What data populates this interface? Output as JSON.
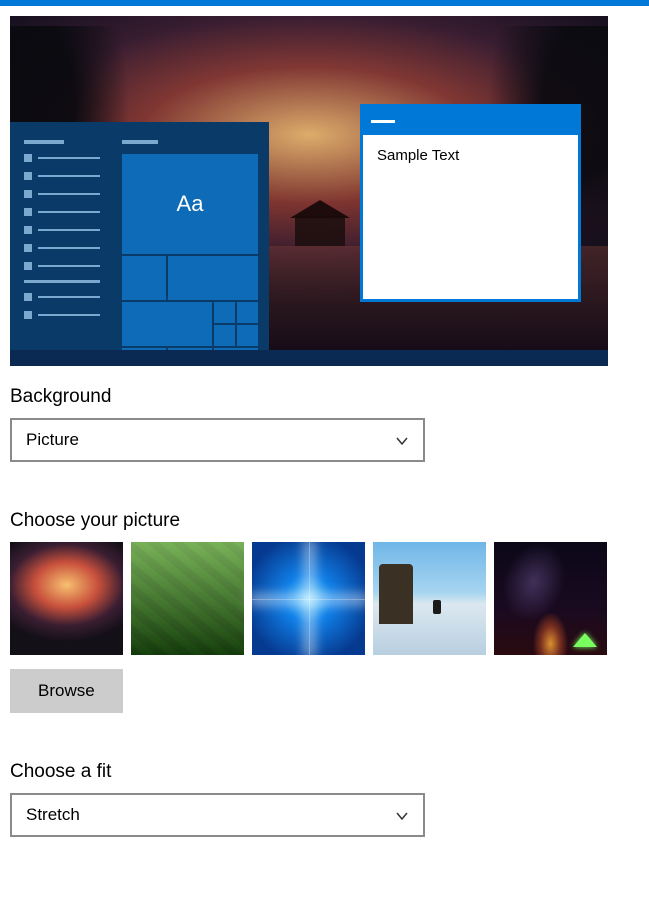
{
  "preview": {
    "tile_label": "Aa",
    "sample_window_text": "Sample Text"
  },
  "background": {
    "label": "Background",
    "selected": "Picture"
  },
  "choose_picture": {
    "label": "Choose your picture",
    "browse_label": "Browse",
    "thumbs": [
      {
        "name": "sunset-cabin"
      },
      {
        "name": "green-tea-fields"
      },
      {
        "name": "windows-10-light"
      },
      {
        "name": "beach-rocks"
      },
      {
        "name": "night-sky-tent"
      }
    ]
  },
  "fit": {
    "label": "Choose a fit",
    "selected": "Stretch"
  }
}
